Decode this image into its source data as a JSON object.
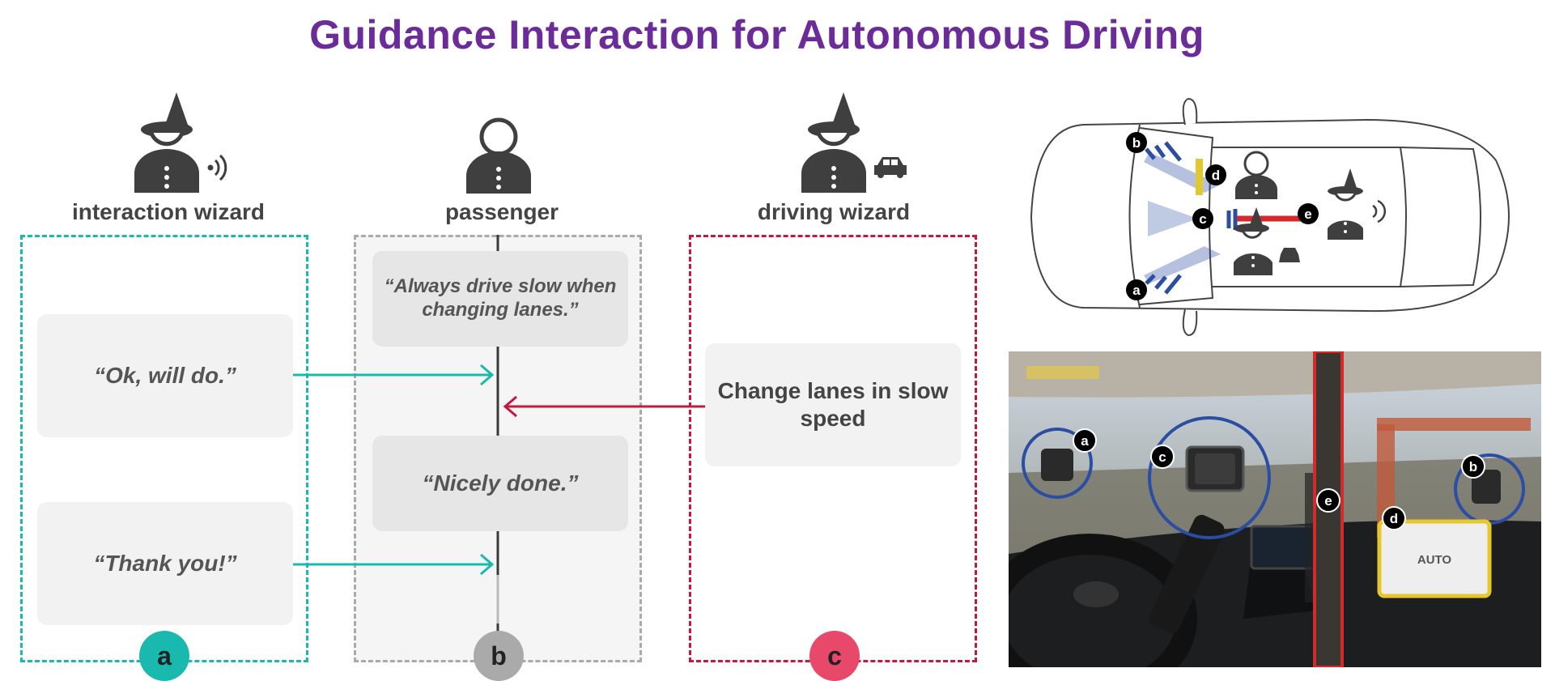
{
  "title": "Guidance Interaction for Autonomous Driving",
  "columns": {
    "interaction_wizard": {
      "label": "interaction wizard",
      "badge": "a"
    },
    "passenger": {
      "label": "passenger",
      "badge": "b"
    },
    "driving_wizard": {
      "label": "driving wizard",
      "badge": "c"
    }
  },
  "messages": {
    "always_drive_slow": "“Always drive slow when changing lanes.”",
    "ok_will_do": "“Ok, will do.”",
    "change_lanes": "Change lanes in slow speed",
    "nicely_done": "“Nicely done.”",
    "thank_you": "“Thank you!”"
  },
  "car_diagram": {
    "markers": [
      "a",
      "b",
      "c",
      "d",
      "e"
    ]
  },
  "photo": {
    "markers": [
      "a",
      "b",
      "c",
      "d",
      "e"
    ],
    "screen_label": "AUTO"
  },
  "colors": {
    "title": "#6b2c9a",
    "teal": "#19b9b0",
    "red": "#c8173f",
    "pink": "#e8486a",
    "gray": "#aaaaaa",
    "icon": "#3f3f3f"
  }
}
